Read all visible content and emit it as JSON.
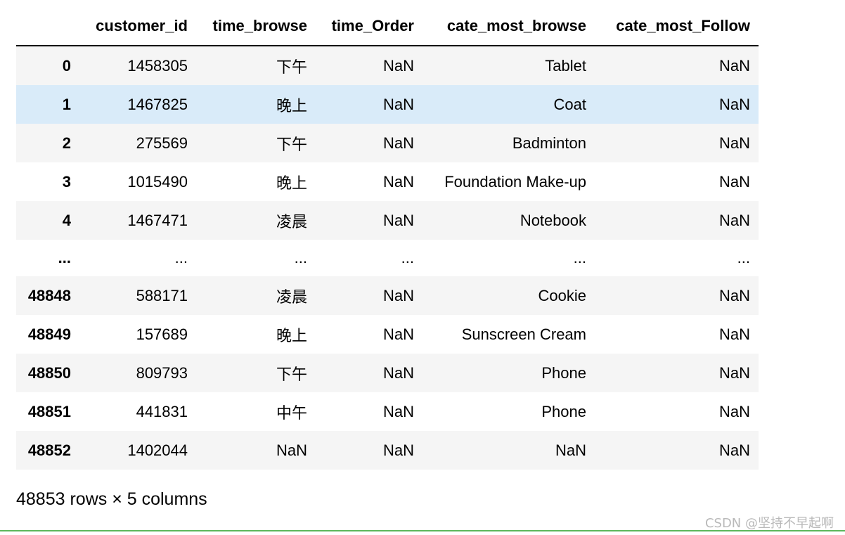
{
  "table": {
    "columns": [
      "",
      "customer_id",
      "time_browse",
      "time_Order",
      "cate_most_browse",
      "cate_most_Follow"
    ],
    "rows": [
      {
        "index": "0",
        "cells": [
          "1458305",
          "下午",
          "NaN",
          "Tablet",
          "NaN"
        ]
      },
      {
        "index": "1",
        "cells": [
          "1467825",
          "晚上",
          "NaN",
          "Coat",
          "NaN"
        ]
      },
      {
        "index": "2",
        "cells": [
          "275569",
          "下午",
          "NaN",
          "Badminton",
          "NaN"
        ]
      },
      {
        "index": "3",
        "cells": [
          "1015490",
          "晚上",
          "NaN",
          "Foundation Make-up",
          "NaN"
        ]
      },
      {
        "index": "4",
        "cells": [
          "1467471",
          "凌晨",
          "NaN",
          "Notebook",
          "NaN"
        ]
      },
      {
        "index": "...",
        "cells": [
          "...",
          "...",
          "...",
          "...",
          "..."
        ]
      },
      {
        "index": "48848",
        "cells": [
          "588171",
          "凌晨",
          "NaN",
          "Cookie",
          "NaN"
        ]
      },
      {
        "index": "48849",
        "cells": [
          "157689",
          "晚上",
          "NaN",
          "Sunscreen Cream",
          "NaN"
        ]
      },
      {
        "index": "48850",
        "cells": [
          "809793",
          "下午",
          "NaN",
          "Phone",
          "NaN"
        ]
      },
      {
        "index": "48851",
        "cells": [
          "441831",
          "中午",
          "NaN",
          "Phone",
          "NaN"
        ]
      },
      {
        "index": "48852",
        "cells": [
          "1402044",
          "NaN",
          "NaN",
          "NaN",
          "NaN"
        ]
      }
    ]
  },
  "summary": "48853 rows × 5 columns",
  "watermark": "CSDN @坚持不早起啊",
  "colors": {
    "row_stripe": "#f5f5f5",
    "row_hover": "#d9ebf9",
    "accent_line": "#5cb85c"
  }
}
